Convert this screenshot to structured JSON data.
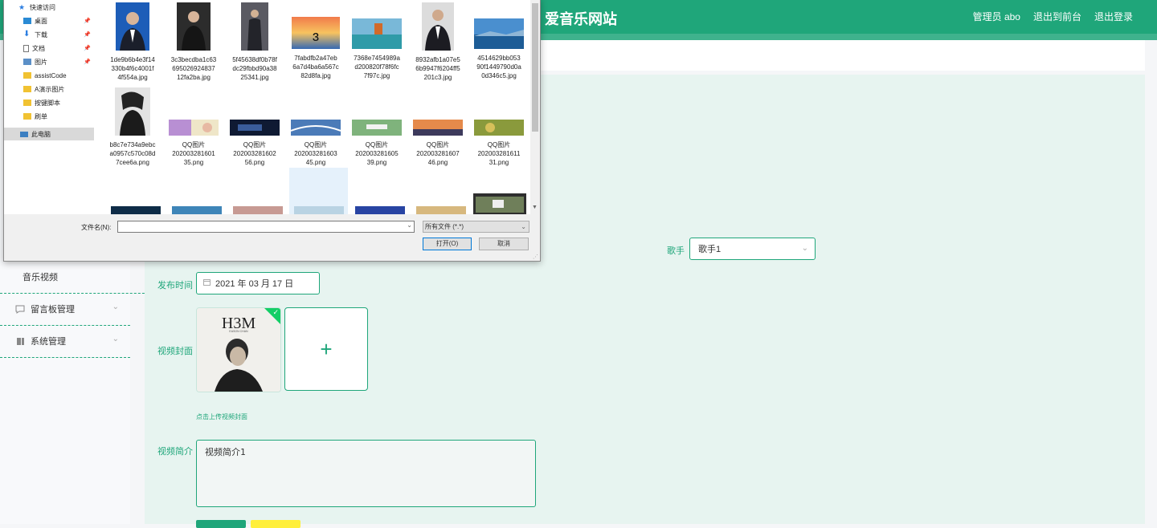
{
  "header": {
    "site_title": "爱音乐网站",
    "admin_label": "管理员 abo",
    "back_label": "退出到前台",
    "logout_label": "退出登录"
  },
  "sidebar": {
    "items": [
      {
        "label": "音乐视频"
      },
      {
        "label": "留言板管理"
      },
      {
        "label": "系统管理"
      }
    ]
  },
  "form": {
    "singer_label": "歌手",
    "singer_value": "歌手1",
    "release_label": "发布时间",
    "release_value": "2021 年 03 月 17 日",
    "cover_label": "视频封面",
    "cover_tip": "点击上传视频封面",
    "cover_image_text": "H3M",
    "cover_image_subtext": "EASON CHAN",
    "desc_label": "视频简介",
    "desc_value": "视频简介1"
  },
  "dialog": {
    "nav": [
      {
        "label": "快速访问",
        "icon": "star-icon"
      },
      {
        "label": "桌面",
        "icon": "desktop-icon",
        "pinned": true
      },
      {
        "label": "下载",
        "icon": "download-icon",
        "pinned": true
      },
      {
        "label": "文档",
        "icon": "document-icon",
        "pinned": true
      },
      {
        "label": "图片",
        "icon": "picture-icon",
        "pinned": true
      },
      {
        "label": "assistCode",
        "icon": "folder-icon"
      },
      {
        "label": "A演示图片",
        "icon": "folder-icon"
      },
      {
        "label": "按键脚本",
        "icon": "folder-icon"
      },
      {
        "label": "刷单",
        "icon": "folder-icon"
      },
      {
        "label": "此电脑",
        "icon": "computer-icon"
      }
    ],
    "files_row1": [
      {
        "name": "1de9b6b4e3f14330b4f6c4001f4f554a.jpg",
        "lines": [
          "1de9b6b4e3f14",
          "330b4f6c4001f",
          "4f554a.jpg"
        ]
      },
      {
        "name": "3c3becdba1c63695026924837 12fa2ba.jpg",
        "lines": [
          "3c3becdba1c63",
          "695026924837",
          "12fa2ba.jpg"
        ]
      },
      {
        "name": "5f45638df0b78fdc29fbbd90a3825341.jpg",
        "lines": [
          "5f45638df0b78f",
          "dc29fbbd90a38",
          "25341.jpg"
        ]
      },
      {
        "name": "7fabdfb2a47eb6a7d4ba6a567c82d8fa.jpg",
        "lines": [
          "7fabdfb2a47eb",
          "6a7d4ba6a567c",
          "82d8fa.jpg"
        ]
      },
      {
        "name": "7368e7454989ad200820f78f6fc7f97c.jpg",
        "lines": [
          "7368e7454989a",
          "d200820f78f6fc",
          "7f97c.jpg"
        ]
      },
      {
        "name": "8932afb1a07e56b9947f6204ff5201c3.jpg",
        "lines": [
          "8932afb1a07e5",
          "6b9947f6204ff5",
          "201c3.jpg"
        ]
      },
      {
        "name": "4514629bb05390f1449790d0a0d346c5.jpg",
        "lines": [
          "4514629bb053",
          "90f1449790d0a",
          "0d346c5.jpg"
        ]
      }
    ],
    "files_row2": [
      {
        "name": "b8c7e734a9ebca0957c570c08d7cee6a.png",
        "lines": [
          "b8c7e734a9ebc",
          "a0957c570c08d",
          "7cee6a.png"
        ]
      },
      {
        "name": "QQ图片20200328160135.png",
        "lines": [
          "QQ图片",
          "202003281601",
          "35.png"
        ]
      },
      {
        "name": "QQ图片20200328160256.png",
        "lines": [
          "QQ图片",
          "202003281602",
          "56.png"
        ]
      },
      {
        "name": "QQ图片20200328160345.png",
        "lines": [
          "QQ图片",
          "202003281603",
          "45.png"
        ]
      },
      {
        "name": "QQ图片20200328160539.png",
        "lines": [
          "QQ图片",
          "202003281605",
          "39.png"
        ]
      },
      {
        "name": "QQ图片20200328160746.png",
        "lines": [
          "QQ图片",
          "202003281607",
          "46.png"
        ]
      },
      {
        "name": "QQ图片20200328161131.png",
        "lines": [
          "QQ图片",
          "202003281611",
          "31.png"
        ]
      }
    ],
    "filename_label": "文件名(N):",
    "filename_value": "",
    "filetype_value": "所有文件 (*.*)",
    "open_label": "打开(O)",
    "cancel_label": "取消"
  },
  "colors": {
    "brand": "#1fa67a",
    "panel": "#e7f4f0",
    "success": "#13ce66",
    "warning": "#ffef3b"
  }
}
